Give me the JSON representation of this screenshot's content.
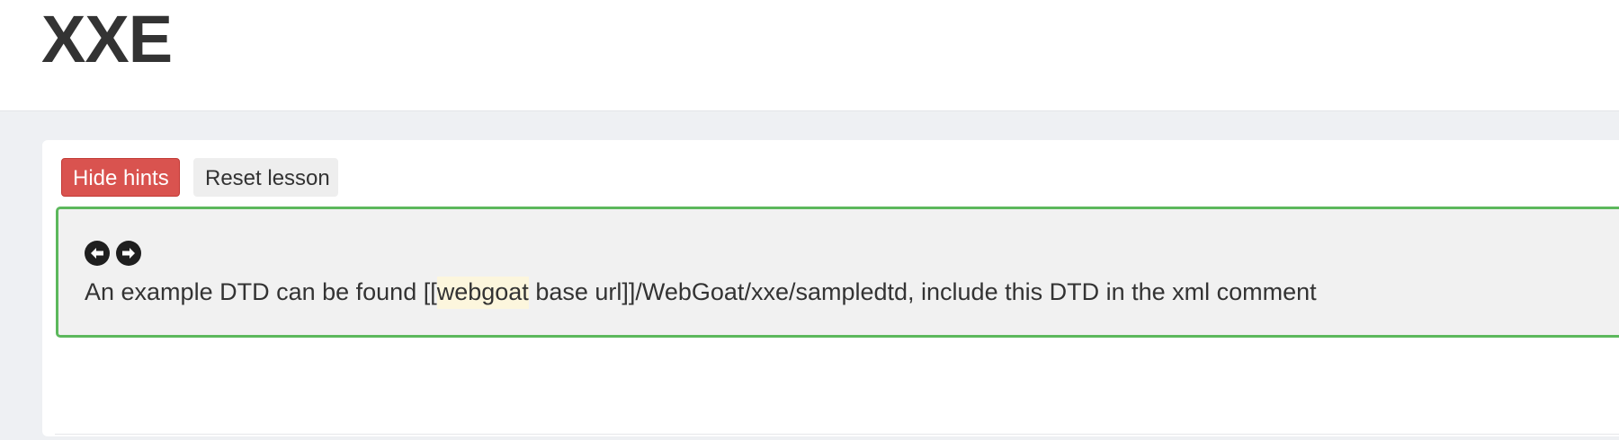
{
  "lesson": {
    "title": "XXE"
  },
  "toolbar": {
    "hide_hints_label": "Hide hints",
    "reset_lesson_label": "Reset lesson"
  },
  "hint": {
    "prev_icon": "arrow-circle-left-icon",
    "next_icon": "arrow-circle-right-icon",
    "text_before": "An example DTD can be found [[",
    "highlighted_word": "webgoat",
    "text_after": " base url]]/WebGoat/xxe/sampledtd, include this DTD in the xml comment"
  },
  "colors": {
    "hide_button": "#d9534f",
    "hint_border": "#5cb85c",
    "highlight": "#fcf6dd"
  }
}
